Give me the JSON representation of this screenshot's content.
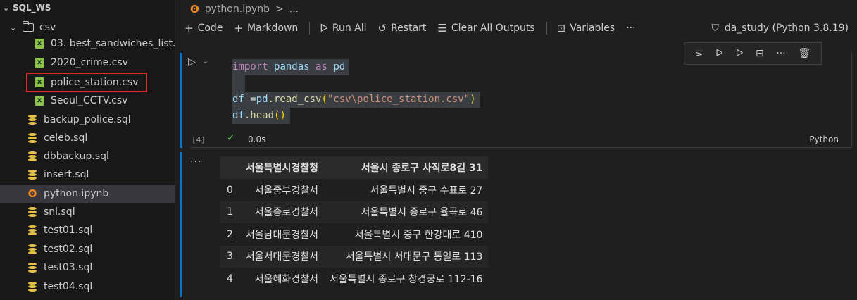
{
  "sidebar": {
    "root_label": "SQL_WS",
    "folder_label": "csv",
    "files": [
      {
        "label": "03. best_sandwiches_list...",
        "type": "csv"
      },
      {
        "label": "2020_crime.csv",
        "type": "csv"
      },
      {
        "label": "police_station.csv",
        "type": "csv"
      },
      {
        "label": "Seoul_CCTV.csv",
        "type": "csv"
      },
      {
        "label": "backup_police.sql",
        "type": "sql"
      },
      {
        "label": "celeb.sql",
        "type": "sql"
      },
      {
        "label": "dbbackup.sql",
        "type": "sql"
      },
      {
        "label": "insert.sql",
        "type": "sql"
      },
      {
        "label": "python.ipynb",
        "type": "notebook"
      },
      {
        "label": "snl.sql",
        "type": "sql"
      },
      {
        "label": "test01.sql",
        "type": "sql"
      },
      {
        "label": "test02.sql",
        "type": "sql"
      },
      {
        "label": "test03.sql",
        "type": "sql"
      },
      {
        "label": "test04.sql",
        "type": "sql"
      }
    ]
  },
  "breadcrumb": {
    "file": "python.ipynb",
    "sep": ">",
    "more": "..."
  },
  "toolbar": {
    "code": "Code",
    "markdown": "Markdown",
    "run_all": "Run All",
    "restart": "Restart",
    "clear_outputs": "Clear All Outputs",
    "variables": "Variables",
    "more": "···",
    "kernel": "da_study (Python 3.8.19)"
  },
  "cell": {
    "exec_count": "[4]",
    "time": "0.0s",
    "language": "Python",
    "code": {
      "import_kw": "import",
      "module": "pandas",
      "as_kw": "as",
      "alias": "pd",
      "var": "df",
      "assign": " =",
      "call_obj": "pd",
      "call_fn": ".read_csv",
      "open": "(",
      "path": "\"csv\\police_station.csv\"",
      "close": ")",
      "head_obj": "df",
      "head_fn": ".head",
      "head_paren": "()"
    }
  },
  "output": {
    "dots": "···",
    "headers": [
      "",
      "서울특별시경찰청",
      "서울시 종로구 사직로8길 31"
    ],
    "rows": [
      [
        "0",
        "서울중부경찰서",
        "서울특별시 중구 수표로 27"
      ],
      [
        "1",
        "서울종로경찰서",
        "서울특별시 종로구 율곡로 46"
      ],
      [
        "2",
        "서울남대문경찰서",
        "서울특별시 중구 한강대로 410"
      ],
      [
        "3",
        "서울서대문경찰서",
        "서울특별시 서대문구 통일로 113"
      ],
      [
        "4",
        "서울혜화경찰서",
        "서울특별시 종로구 창경궁로 112-16"
      ]
    ]
  },
  "colors": {
    "accent": "#0e73c9",
    "highlight": "#e0262b"
  }
}
